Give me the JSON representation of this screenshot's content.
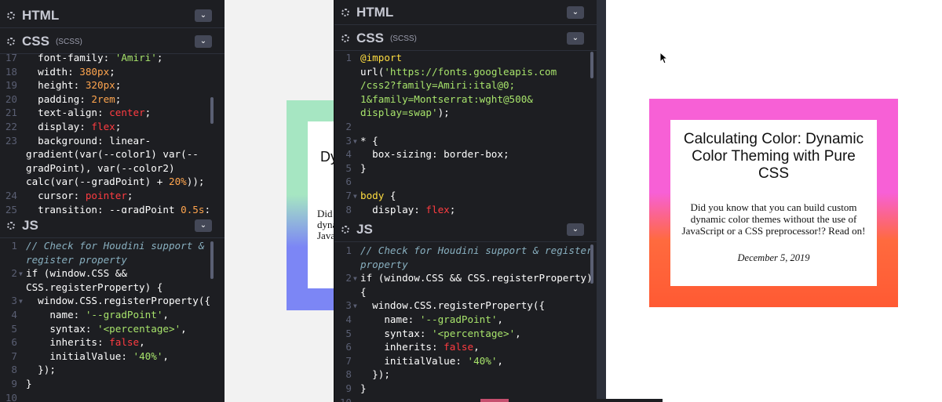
{
  "left_editor": {
    "html_panel": {
      "title": "HTML"
    },
    "css_panel": {
      "title": "CSS",
      "subtitle": "(SCSS)"
    },
    "js_panel": {
      "title": "JS"
    }
  },
  "right_editor": {
    "html_panel": {
      "title": "HTML"
    },
    "css_panel": {
      "title": "CSS",
      "subtitle": "(SCSS)"
    },
    "js_panel": {
      "title": "JS"
    }
  },
  "preview_card": {
    "title": "Calculating Color: Dynamic Color Theming with Pure CSS",
    "body": "Did you know that you can build custom dynamic color themes without the use of JavaScript or a CSS preprocessor!? Read on!",
    "date": "December 5, 2019",
    "gradient_top": "#f760d6",
    "gradient_bottom": "#ff5a33"
  },
  "preview_card_left": {
    "peek_title": "Dy",
    "peek_body_1": "Did",
    "peek_body_2": "dyna",
    "peek_body_3": "Java",
    "gradient_top": "#a6e6c2",
    "gradient_bottom": "#7c86f5"
  },
  "icons": {
    "settings": "gear-icon",
    "collapse": "chevron-down-icon",
    "pointer": "mouse-pointer-icon"
  },
  "colors": {
    "editor_bg": "#1d1e22",
    "string": "#a7e36b",
    "number": "#ffa54e",
    "comment": "#88afbf"
  }
}
